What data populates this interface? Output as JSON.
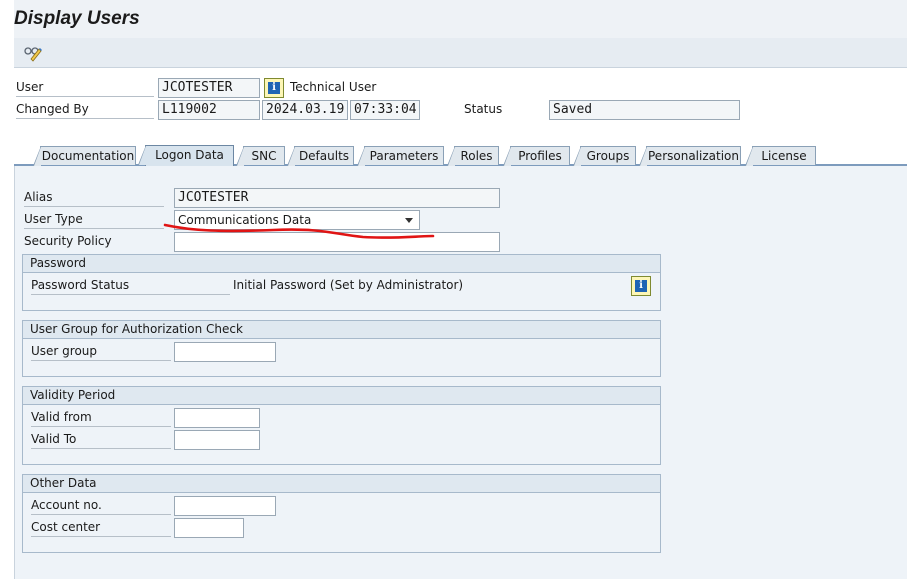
{
  "window": {
    "title": "Display Users"
  },
  "toolbar": {
    "tool_icon": "glasses-pencil-icon"
  },
  "header": {
    "user_label": "User",
    "user_value": "JCOTESTER",
    "technical_user_label": "Technical User",
    "changed_by_label": "Changed By",
    "changed_by_value": "L119002",
    "date_value": "2024.03.19",
    "time_value": "07:33:04",
    "status_label": "Status",
    "status_value": "Saved"
  },
  "tabs": [
    {
      "label": "Documentation",
      "active": false
    },
    {
      "label": "Logon Data",
      "active": true
    },
    {
      "label": "SNC",
      "active": false
    },
    {
      "label": "Defaults",
      "active": false
    },
    {
      "label": "Parameters",
      "active": false
    },
    {
      "label": "Roles",
      "active": false
    },
    {
      "label": "Profiles",
      "active": false
    },
    {
      "label": "Groups",
      "active": false
    },
    {
      "label": "Personalization",
      "active": false
    },
    {
      "label": "License",
      "active": false
    }
  ],
  "logon": {
    "alias_label": "Alias",
    "alias_value": "JCOTESTER",
    "user_type_label": "User Type",
    "user_type_value": "Communications Data",
    "security_policy_label": "Security Policy",
    "security_policy_value": ""
  },
  "password": {
    "title": "Password",
    "status_label": "Password Status",
    "status_value": "Initial Password (Set by Administrator)"
  },
  "auth_group": {
    "title": "User Group for Authorization Check",
    "user_group_label": "User group",
    "user_group_value": ""
  },
  "validity": {
    "title": "Validity Period",
    "valid_from_label": "Valid from",
    "valid_from_value": "",
    "valid_to_label": "Valid To",
    "valid_to_value": ""
  },
  "other": {
    "title": "Other Data",
    "account_label": "Account no.",
    "account_value": "",
    "cost_center_label": "Cost center",
    "cost_center_value": ""
  },
  "annotation": {
    "color": "#e01414"
  }
}
